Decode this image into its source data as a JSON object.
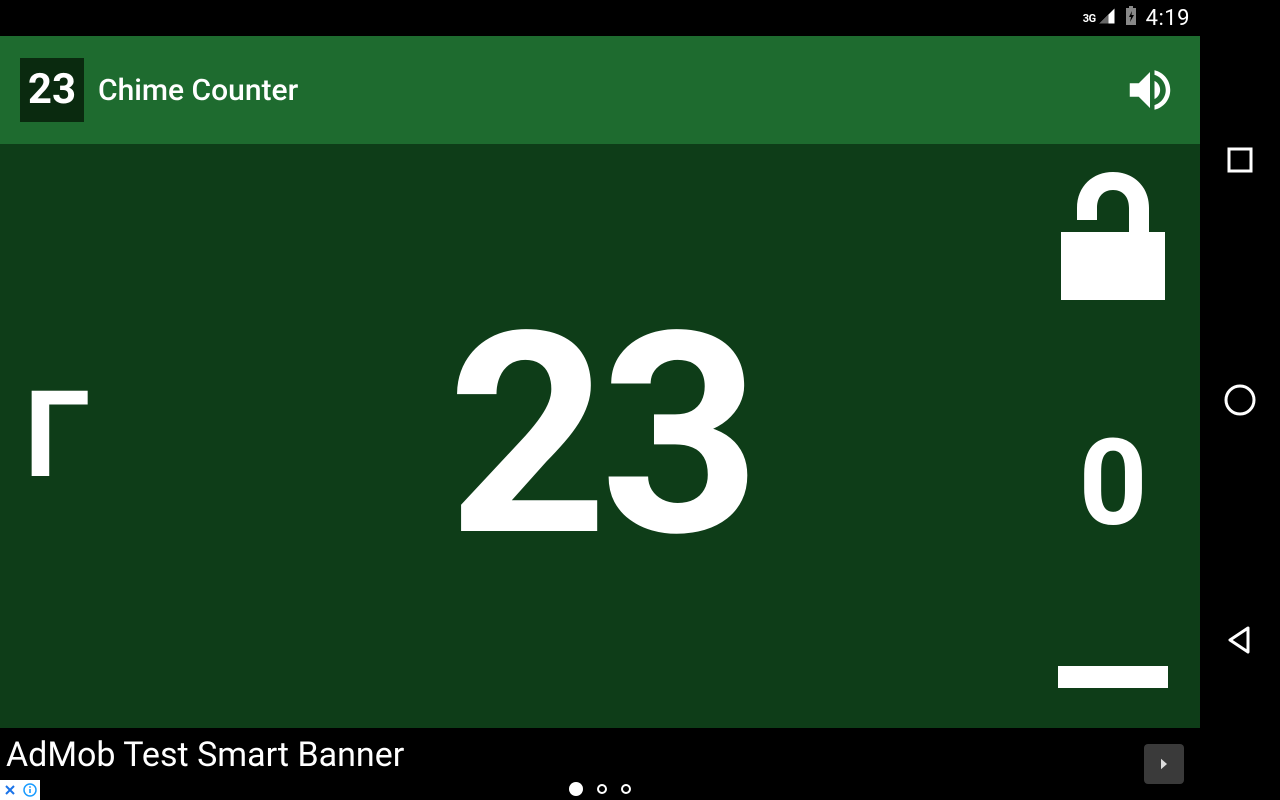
{
  "status": {
    "network_label": "3G",
    "time": "4:19"
  },
  "action_bar": {
    "icon_text": "23",
    "title": "Chime Counter"
  },
  "main": {
    "counter": "23",
    "left_glyph": "Г",
    "zero_label": "0"
  },
  "ad": {
    "text": "AdMob Test Smart Banner"
  }
}
